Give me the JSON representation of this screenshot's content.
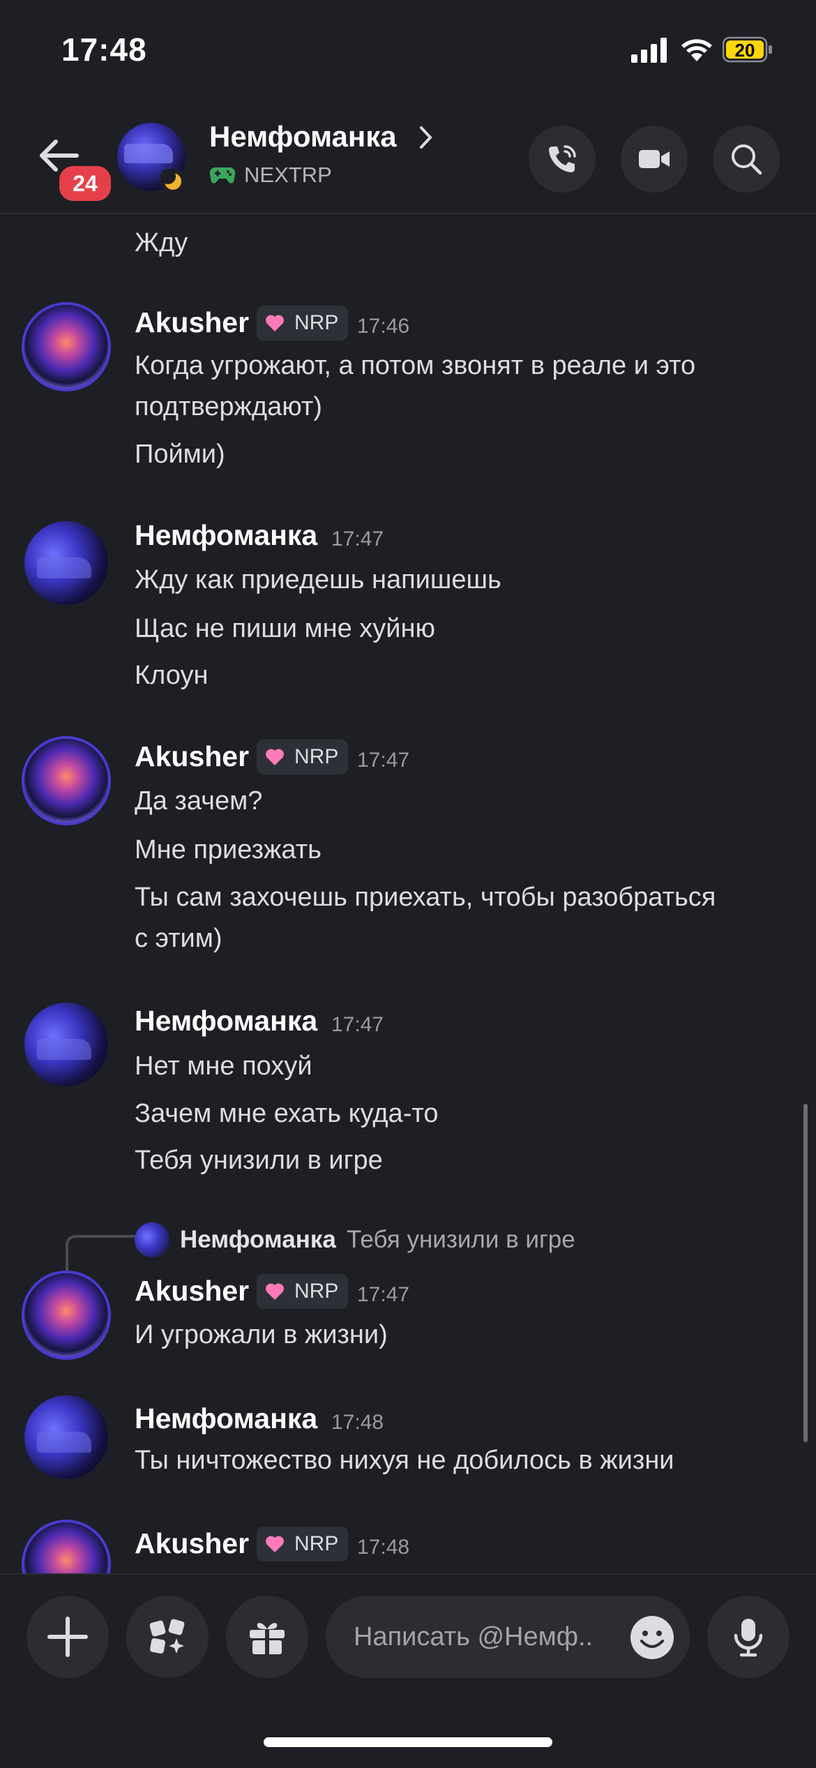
{
  "status_bar": {
    "time": "17:48",
    "battery": "20"
  },
  "header": {
    "unread_count": "24",
    "channel_name": "Немфоманка",
    "activity": "NEXTRP"
  },
  "messages": [
    {
      "lines": [
        "Жду"
      ]
    },
    {
      "author": "Akusher",
      "tag": "NRP",
      "time": "17:46",
      "lines": [
        "Когда угрожают, а потом звонят в реале и это",
        "подтверждают)",
        "Пойми)"
      ]
    },
    {
      "author": "Немфоманка",
      "time": "17:47",
      "lines": [
        "Жду как приедешь напишешь",
        "Щас не пиши мне хуйню",
        "Клоун"
      ]
    },
    {
      "author": "Akusher",
      "tag": "NRP",
      "time": "17:47",
      "lines": [
        "Да зачем?",
        "Мне приезжать",
        "Ты сам захочешь приехать, чтобы разобраться",
        "с этим)"
      ]
    },
    {
      "author": "Немфоманка",
      "time": "17:47",
      "lines": [
        "Нет мне похуй",
        "Зачем мне ехать куда-то",
        "Тебя унизили в игре"
      ]
    },
    {
      "author": "Akusher",
      "tag": "NRP",
      "time": "17:47",
      "reply": {
        "author": "Немфоманка",
        "text": "Тебя унизили в игре"
      },
      "lines": [
        "И угрожали в жизни)"
      ]
    },
    {
      "author": "Немфоманка",
      "time": "17:48",
      "lines": [
        "Ты ничтожество нихуя не добилось в жизни"
      ]
    },
    {
      "author": "Akusher",
      "tag": "NRP",
      "time": "17:48",
      "lines": []
    }
  ],
  "composer": {
    "placeholder": "Написать @Немф.."
  },
  "colors": {
    "background": "#1e1f24",
    "badge": "#e5404a",
    "activity_icon": "#3ba55d"
  },
  "icons": [
    "back-arrow-icon",
    "moon-icon",
    "gamepad-icon",
    "chevron-right-icon",
    "phone-call-icon",
    "video-camera-icon",
    "search-icon",
    "plus-icon",
    "apps-icon",
    "gift-icon",
    "emoji-icon",
    "microphone-icon",
    "heart-icon"
  ]
}
